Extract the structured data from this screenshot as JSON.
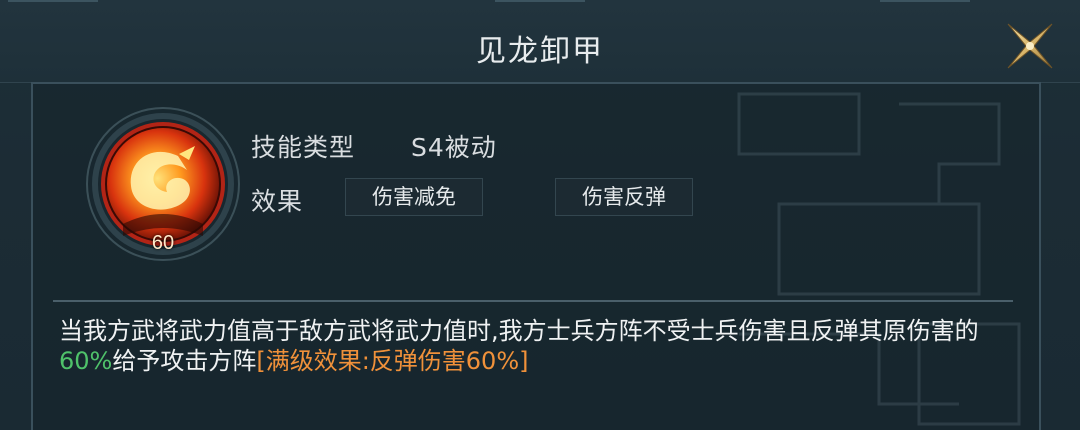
{
  "window": {
    "title": "见龙卸甲"
  },
  "skill": {
    "level": "60",
    "icon": "dragon-flame-icon",
    "type_label": "技能类型",
    "type_value": "S4被动",
    "effect_label": "效果",
    "effect_tags": [
      "伤害减免",
      "伤害反弹"
    ]
  },
  "description": {
    "part1": "当我方武将武力值高于敌方武将武力值时,我方士兵方阵不受士兵伤害且反弹其原伤害的",
    "percent": "60%",
    "part2": "给予攻击方阵",
    "max_effect": "[满级效果:反弹伤害60%]"
  },
  "colors": {
    "highlight_green": "#4fc26a",
    "highlight_orange": "#f0913a",
    "background": "#1a2a33",
    "border": "#3a505c"
  }
}
